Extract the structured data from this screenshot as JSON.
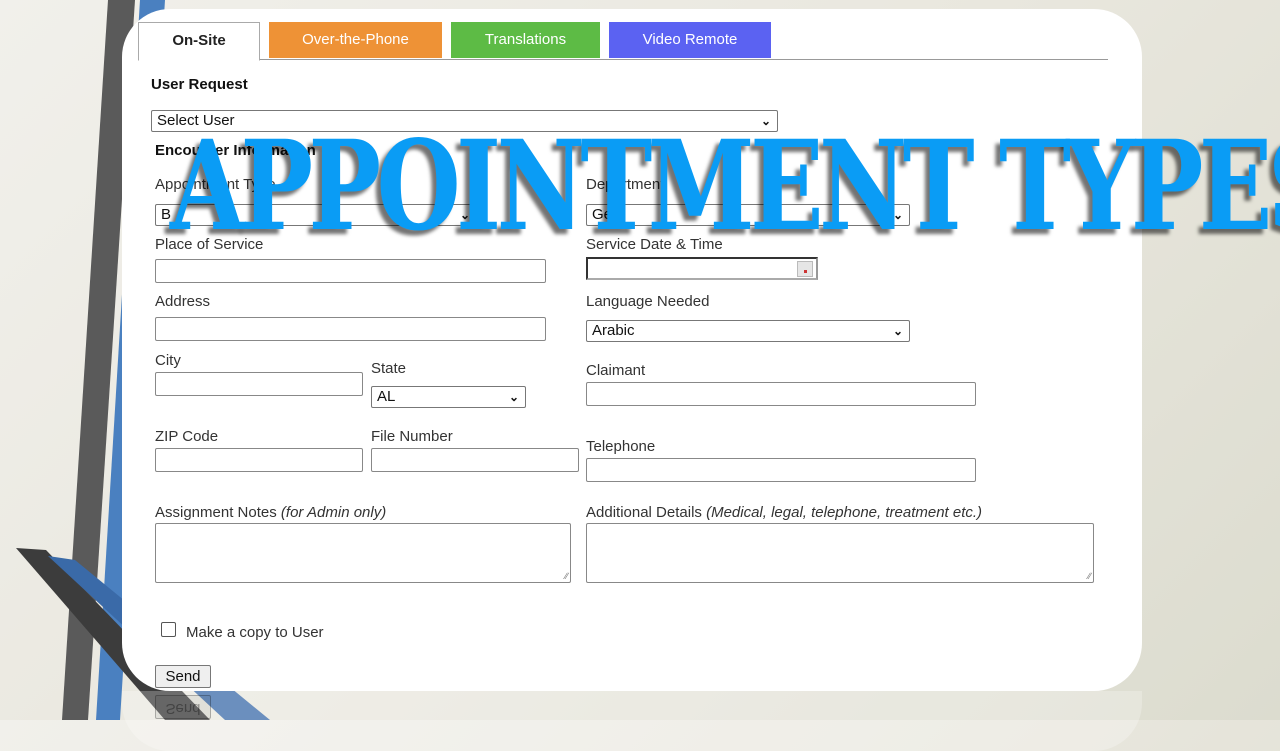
{
  "tabs": [
    {
      "label": "On-Site",
      "active": true,
      "color": "#ffffff"
    },
    {
      "label": "Over-the-Phone",
      "active": false,
      "color": "#ee9236"
    },
    {
      "label": "Translations",
      "active": false,
      "color": "#5dbb45"
    },
    {
      "label": "Video Remote",
      "active": false,
      "color": "#5b62f2"
    }
  ],
  "user_request": {
    "heading": "User Request",
    "select_value": "Select User"
  },
  "encounter": {
    "heading": "Encounter Information",
    "appointment_type_label": "Appointment Type",
    "appointment_type_value": "B",
    "department_label": "Department",
    "department_value": "Ge",
    "place_of_service_label": "Place of Service",
    "place_of_service_value": "",
    "service_datetime_label": "Service Date & Time",
    "service_datetime_value": "",
    "address_label": "Address",
    "address_value": "",
    "language_label": "Language Needed",
    "language_value": "Arabic",
    "city_label": "City",
    "city_value": "",
    "state_label": "State",
    "state_value": "AL",
    "claimant_label": "Claimant",
    "claimant_value": "",
    "zip_label": "ZIP Code",
    "zip_value": "",
    "file_number_label": "File Number",
    "file_number_value": "",
    "telephone_label": "Telephone",
    "telephone_value": "",
    "assignment_notes_label": "Assignment Notes",
    "assignment_notes_hint": "(for Admin only)",
    "additional_details_label": "Additional Details",
    "additional_details_hint": "(Medical, legal, telephone, treatment etc.)"
  },
  "copy_checkbox": {
    "label": "Make a copy to User",
    "checked": false
  },
  "send_button": "Send",
  "overlay_title": "APPOINTMENT TYPES",
  "icons": {
    "chevron": "chevron-down-icon",
    "calendar": "calendar-icon",
    "resize": "resize-grip-icon"
  }
}
